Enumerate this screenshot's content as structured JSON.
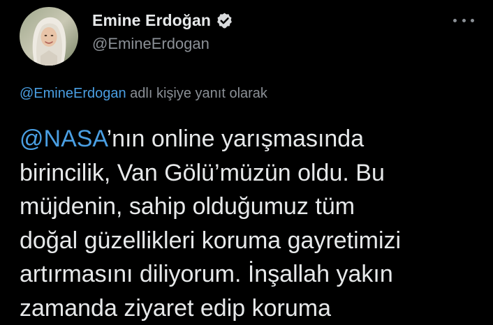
{
  "author": {
    "display_name": "Emine Erdoğan",
    "handle": "@EmineErdogan",
    "verified": true,
    "avatar_icon": "profile-photo"
  },
  "menu": {
    "more_icon": "more-horizontal-icon"
  },
  "reply_context": {
    "handle": "@EmineErdogan",
    "suffix": " adlı kişiye yanıt olarak"
  },
  "tweet": {
    "mention": "@NASA",
    "line1_rest": "’nın online yarışmasında",
    "line2": "birincilik, Van Gölü’müzün oldu. Bu",
    "line3": "müjdenin, sahip olduğumuz tüm",
    "line4": "doğal güzellikleri koruma gayretimizi",
    "line5": "artırmasını diliyorum. İnşallah yakın",
    "line6": "zamanda ziyaret edip koruma"
  },
  "colors": {
    "background": "#000000",
    "text": "#e7e9ea",
    "secondary": "#8b9096",
    "link": "#4a9fe3"
  }
}
